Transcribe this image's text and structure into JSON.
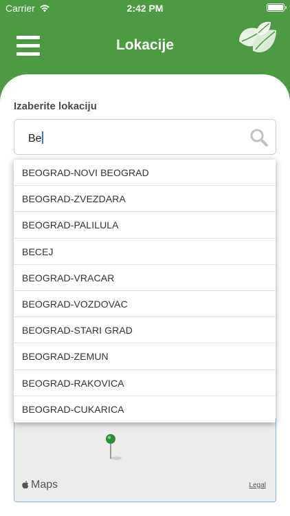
{
  "status_bar": {
    "carrier": "Carrier",
    "time": "2:42 PM"
  },
  "header": {
    "title": "Lokacije",
    "menu_icon": "hamburger-menu-icon",
    "logo_icon": "leaf-logo-icon"
  },
  "form": {
    "label": "Izaberite lokaciju",
    "search_value": "Be",
    "search_icon": "search-icon"
  },
  "suggestions": [
    "BEOGRAD-NOVI BEOGRAD",
    "BEOGRAD-ZVEZDARA",
    "BEOGRAD-PALILULA",
    "BECEJ",
    "BEOGRAD-VRACAR",
    "BEOGRAD-VOZDOVAC",
    "BEOGRAD-STARI GRAD",
    "BEOGRAD-ZEMUN",
    "BEOGRAD-RAKOVICA",
    "BEOGRAD-CUKARICA"
  ],
  "map": {
    "brand": "Maps",
    "legal": "Legal"
  },
  "colors": {
    "brand_green": "#4c9a42",
    "pin_green": "#2e8b3a",
    "caret_blue": "#2f7cf6"
  }
}
